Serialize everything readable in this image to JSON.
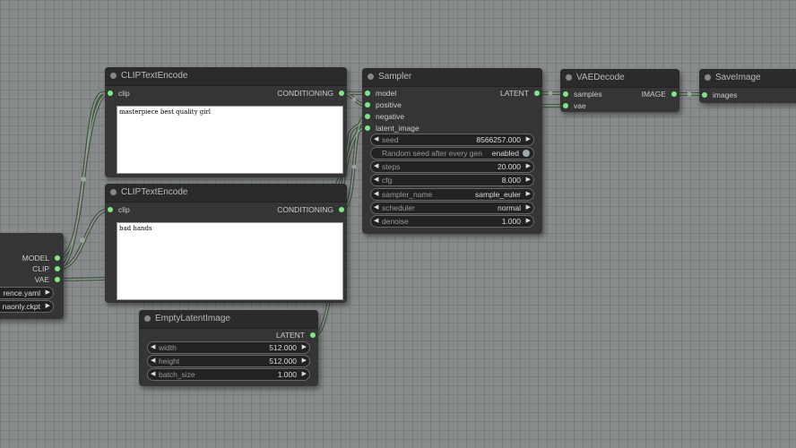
{
  "nodes": {
    "loader": {
      "outputs": [
        "MODEL",
        "CLIP",
        "VAE"
      ],
      "config_value": "rence.yaml",
      "ckpt_value": "naonly.ckpt"
    },
    "clip_pos": {
      "title": "CLIPTextEncode",
      "input": "clip",
      "output": "CONDITIONING",
      "text": "masterpiece best quality girl"
    },
    "clip_neg": {
      "title": "CLIPTextEncode",
      "input": "clip",
      "output": "CONDITIONING",
      "text": "bad hands"
    },
    "sampler": {
      "title": "Sampler",
      "inputs": [
        "model",
        "positive",
        "negative",
        "latent_image"
      ],
      "output": "LATENT",
      "widgets": {
        "seed": {
          "label": "seed",
          "value": "8566257.000"
        },
        "random_seed": {
          "label": "Random seed after every gen",
          "value": "enabled"
        },
        "steps": {
          "label": "steps",
          "value": "20.000"
        },
        "cfg": {
          "label": "cfg",
          "value": "8.000"
        },
        "sampler_name": {
          "label": "sampler_name",
          "value": "sample_euler"
        },
        "scheduler": {
          "label": "scheduler",
          "value": "normal"
        },
        "denoise": {
          "label": "denoise",
          "value": "1.000"
        }
      }
    },
    "vae_decode": {
      "title": "VAEDecode",
      "inputs": [
        "samples",
        "vae"
      ],
      "output": "IMAGE"
    },
    "save_image": {
      "title": "SaveImage",
      "input": "images"
    },
    "empty_latent": {
      "title": "EmptyLatentImage",
      "output": "LATENT",
      "widgets": {
        "width": {
          "label": "width",
          "value": "512.000"
        },
        "height": {
          "label": "height",
          "value": "512.000"
        },
        "batch_size": {
          "label": "batch_size",
          "value": "1.000"
        }
      }
    }
  },
  "colors": {
    "canvas": "#888b8c",
    "node_body": "#353535",
    "node_title": "#2b2b2b",
    "port": "#7ee787",
    "link": "#5f6e5f"
  }
}
